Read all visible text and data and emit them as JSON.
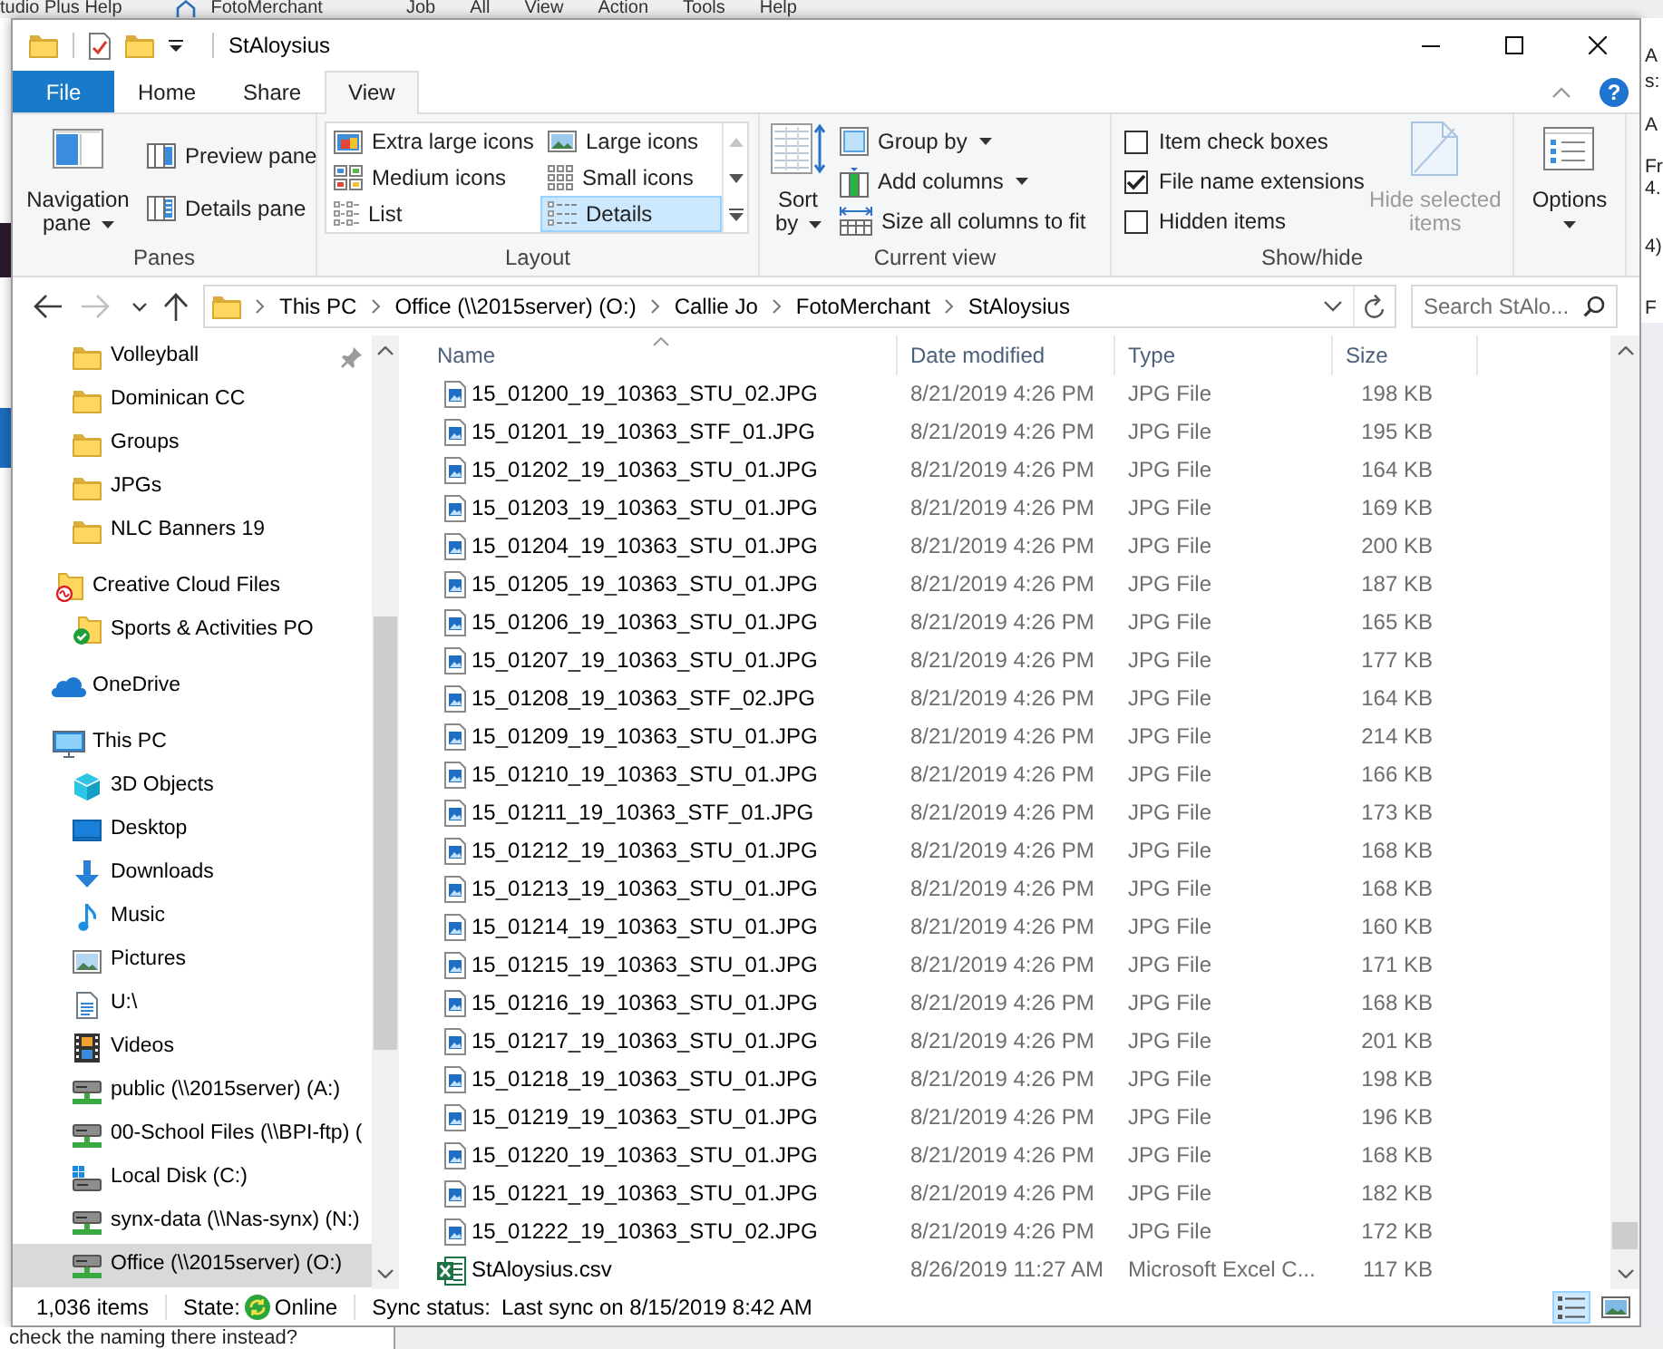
{
  "background_window": {
    "tab_title": "tudio Plus Help",
    "app_title": "FotoMerchant",
    "menu": [
      "Job",
      "All",
      "View",
      "Action",
      "Tools",
      "Help"
    ],
    "side_texts": [
      "A",
      "s:",
      "A",
      "Fr",
      "4.",
      "4)",
      "F"
    ],
    "footer_text": "check the naming there instead?"
  },
  "window": {
    "title": "StAloysius"
  },
  "ribbon": {
    "tabs": [
      {
        "label": "File",
        "kind": "file",
        "selected": false
      },
      {
        "label": "Home",
        "kind": "tab",
        "selected": false
      },
      {
        "label": "Share",
        "kind": "tab",
        "selected": false
      },
      {
        "label": "View",
        "kind": "tab",
        "selected": true
      }
    ],
    "help": "?",
    "panes": {
      "label": "Panes",
      "navigation_pane": "Navigation pane",
      "preview_pane": "Preview pane",
      "details_pane": "Details pane"
    },
    "layout": {
      "label": "Layout",
      "options": [
        {
          "label": "Extra large icons",
          "kind": "extralarge",
          "selected": false
        },
        {
          "label": "Large icons",
          "kind": "large",
          "selected": false
        },
        {
          "label": "Medium icons",
          "kind": "medium",
          "selected": false
        },
        {
          "label": "Small icons",
          "kind": "small",
          "selected": false
        },
        {
          "label": "List",
          "kind": "list",
          "selected": false
        },
        {
          "label": "Details",
          "kind": "details",
          "selected": true
        }
      ]
    },
    "current_view": {
      "label": "Current view",
      "sort_by": "Sort by",
      "group_by": "Group by",
      "add_columns": "Add columns",
      "size_columns": "Size all columns to fit"
    },
    "show_hide": {
      "label": "Show/hide",
      "checkboxes": [
        {
          "label": "Item check boxes",
          "checked": false
        },
        {
          "label": "File name extensions",
          "checked": true
        },
        {
          "label": "Hidden items",
          "checked": false
        }
      ],
      "hide_selected": {
        "label": "Hide selected items",
        "disabled": true
      }
    },
    "options": {
      "label": "Options"
    }
  },
  "address_bar": {
    "nav_buttons": [
      {
        "kind": "back",
        "disabled": false
      },
      {
        "kind": "forward",
        "disabled": true
      },
      {
        "kind": "recent",
        "disabled": false
      },
      {
        "kind": "up",
        "disabled": false
      }
    ],
    "path": [
      "This PC",
      "Office (\\\\2015server) (O:)",
      "Callie Jo",
      "FotoMerchant",
      "StAloysius"
    ]
  },
  "search": {
    "placeholder": "Search StAlo..."
  },
  "sidebar": {
    "quick_access": [
      {
        "label": "Volleyball",
        "kind": "folder",
        "pinned": true,
        "selected": false
      },
      {
        "label": "Dominican CC",
        "kind": "folder",
        "pinned": false,
        "selected": false
      },
      {
        "label": "Groups",
        "kind": "folder",
        "pinned": false,
        "selected": false
      },
      {
        "label": "JPGs",
        "kind": "folder",
        "pinned": false,
        "selected": false
      },
      {
        "label": "NLC Banners 19",
        "kind": "folder",
        "pinned": false,
        "selected": false
      }
    ],
    "tree": [
      {
        "label": "Creative Cloud Files",
        "kind": "ccfolder",
        "selected": false,
        "children": [
          {
            "label": "Sports & Activities PO",
            "kind": "syncedfolder",
            "selected": false
          }
        ]
      },
      {
        "label": "OneDrive",
        "kind": "onedrive",
        "selected": false
      },
      {
        "label": "This PC",
        "kind": "pc",
        "selected": false,
        "children": [
          {
            "label": "3D Objects",
            "kind": "objects",
            "selected": false
          },
          {
            "label": "Desktop",
            "kind": "desktop",
            "selected": false
          },
          {
            "label": "Downloads",
            "kind": "downloads",
            "selected": false
          },
          {
            "label": "Music",
            "kind": "music",
            "selected": false
          },
          {
            "label": "Pictures",
            "kind": "pictures",
            "selected": false
          },
          {
            "label": "U:\\",
            "kind": "document",
            "selected": false
          },
          {
            "label": "Videos",
            "kind": "videos",
            "selected": false
          },
          {
            "label": "public (\\\\2015server) (A:)",
            "kind": "netdrive",
            "selected": false
          },
          {
            "label": "00-School Files (\\\\BPI-ftp) (",
            "kind": "netdrive",
            "selected": false
          },
          {
            "label": "Local Disk (C:)",
            "kind": "localdisk",
            "selected": false
          },
          {
            "label": "synx-data (\\\\Nas-synx) (N:)",
            "kind": "netdrive",
            "selected": false
          },
          {
            "label": "Office (\\\\2015server) (O:)",
            "kind": "netdrive",
            "selected": true
          }
        ]
      }
    ]
  },
  "file_list": {
    "columns": [
      {
        "label": "Name",
        "sorted": true
      },
      {
        "label": "Date modified",
        "sorted": false
      },
      {
        "label": "Type",
        "sorted": false
      },
      {
        "label": "Size",
        "sorted": false
      }
    ],
    "rows": [
      {
        "kind": "jpg",
        "name": "15_01200_19_10363_STU_02.JPG",
        "date": "8/21/2019 4:26 PM",
        "type": "JPG File",
        "size": "198 KB"
      },
      {
        "kind": "jpg",
        "name": "15_01201_19_10363_STF_01.JPG",
        "date": "8/21/2019 4:26 PM",
        "type": "JPG File",
        "size": "195 KB"
      },
      {
        "kind": "jpg",
        "name": "15_01202_19_10363_STU_01.JPG",
        "date": "8/21/2019 4:26 PM",
        "type": "JPG File",
        "size": "164 KB"
      },
      {
        "kind": "jpg",
        "name": "15_01203_19_10363_STU_01.JPG",
        "date": "8/21/2019 4:26 PM",
        "type": "JPG File",
        "size": "169 KB"
      },
      {
        "kind": "jpg",
        "name": "15_01204_19_10363_STU_01.JPG",
        "date": "8/21/2019 4:26 PM",
        "type": "JPG File",
        "size": "200 KB"
      },
      {
        "kind": "jpg",
        "name": "15_01205_19_10363_STU_01.JPG",
        "date": "8/21/2019 4:26 PM",
        "type": "JPG File",
        "size": "187 KB"
      },
      {
        "kind": "jpg",
        "name": "15_01206_19_10363_STU_01.JPG",
        "date": "8/21/2019 4:26 PM",
        "type": "JPG File",
        "size": "165 KB"
      },
      {
        "kind": "jpg",
        "name": "15_01207_19_10363_STU_01.JPG",
        "date": "8/21/2019 4:26 PM",
        "type": "JPG File",
        "size": "177 KB"
      },
      {
        "kind": "jpg",
        "name": "15_01208_19_10363_STF_02.JPG",
        "date": "8/21/2019 4:26 PM",
        "type": "JPG File",
        "size": "164 KB"
      },
      {
        "kind": "jpg",
        "name": "15_01209_19_10363_STU_01.JPG",
        "date": "8/21/2019 4:26 PM",
        "type": "JPG File",
        "size": "214 KB"
      },
      {
        "kind": "jpg",
        "name": "15_01210_19_10363_STU_01.JPG",
        "date": "8/21/2019 4:26 PM",
        "type": "JPG File",
        "size": "166 KB"
      },
      {
        "kind": "jpg",
        "name": "15_01211_19_10363_STF_01.JPG",
        "date": "8/21/2019 4:26 PM",
        "type": "JPG File",
        "size": "173 KB"
      },
      {
        "kind": "jpg",
        "name": "15_01212_19_10363_STU_01.JPG",
        "date": "8/21/2019 4:26 PM",
        "type": "JPG File",
        "size": "168 KB"
      },
      {
        "kind": "jpg",
        "name": "15_01213_19_10363_STU_01.JPG",
        "date": "8/21/2019 4:26 PM",
        "type": "JPG File",
        "size": "168 KB"
      },
      {
        "kind": "jpg",
        "name": "15_01214_19_10363_STU_01.JPG",
        "date": "8/21/2019 4:26 PM",
        "type": "JPG File",
        "size": "160 KB"
      },
      {
        "kind": "jpg",
        "name": "15_01215_19_10363_STU_01.JPG",
        "date": "8/21/2019 4:26 PM",
        "type": "JPG File",
        "size": "171 KB"
      },
      {
        "kind": "jpg",
        "name": "15_01216_19_10363_STU_01.JPG",
        "date": "8/21/2019 4:26 PM",
        "type": "JPG File",
        "size": "168 KB"
      },
      {
        "kind": "jpg",
        "name": "15_01217_19_10363_STU_01.JPG",
        "date": "8/21/2019 4:26 PM",
        "type": "JPG File",
        "size": "201 KB"
      },
      {
        "kind": "jpg",
        "name": "15_01218_19_10363_STU_01.JPG",
        "date": "8/21/2019 4:26 PM",
        "type": "JPG File",
        "size": "198 KB"
      },
      {
        "kind": "jpg",
        "name": "15_01219_19_10363_STU_01.JPG",
        "date": "8/21/2019 4:26 PM",
        "type": "JPG File",
        "size": "196 KB"
      },
      {
        "kind": "jpg",
        "name": "15_01220_19_10363_STU_01.JPG",
        "date": "8/21/2019 4:26 PM",
        "type": "JPG File",
        "size": "168 KB"
      },
      {
        "kind": "jpg",
        "name": "15_01221_19_10363_STU_01.JPG",
        "date": "8/21/2019 4:26 PM",
        "type": "JPG File",
        "size": "182 KB"
      },
      {
        "kind": "jpg",
        "name": "15_01222_19_10363_STU_02.JPG",
        "date": "8/21/2019 4:26 PM",
        "type": "JPG File",
        "size": "172 KB"
      },
      {
        "kind": "csv",
        "name": "StAloysius.csv",
        "date": "8/26/2019 11:27 AM",
        "type": "Microsoft Excel C...",
        "size": "117 KB"
      }
    ]
  },
  "status_bar": {
    "item_count": "1,036 items",
    "state_label": "State:",
    "state": "Online",
    "sync_label": "Sync status:",
    "sync": "Last sync on 8/15/2019 8:42 AM",
    "views": [
      {
        "kind": "details",
        "selected": true
      },
      {
        "kind": "largeicons",
        "selected": false
      }
    ]
  }
}
